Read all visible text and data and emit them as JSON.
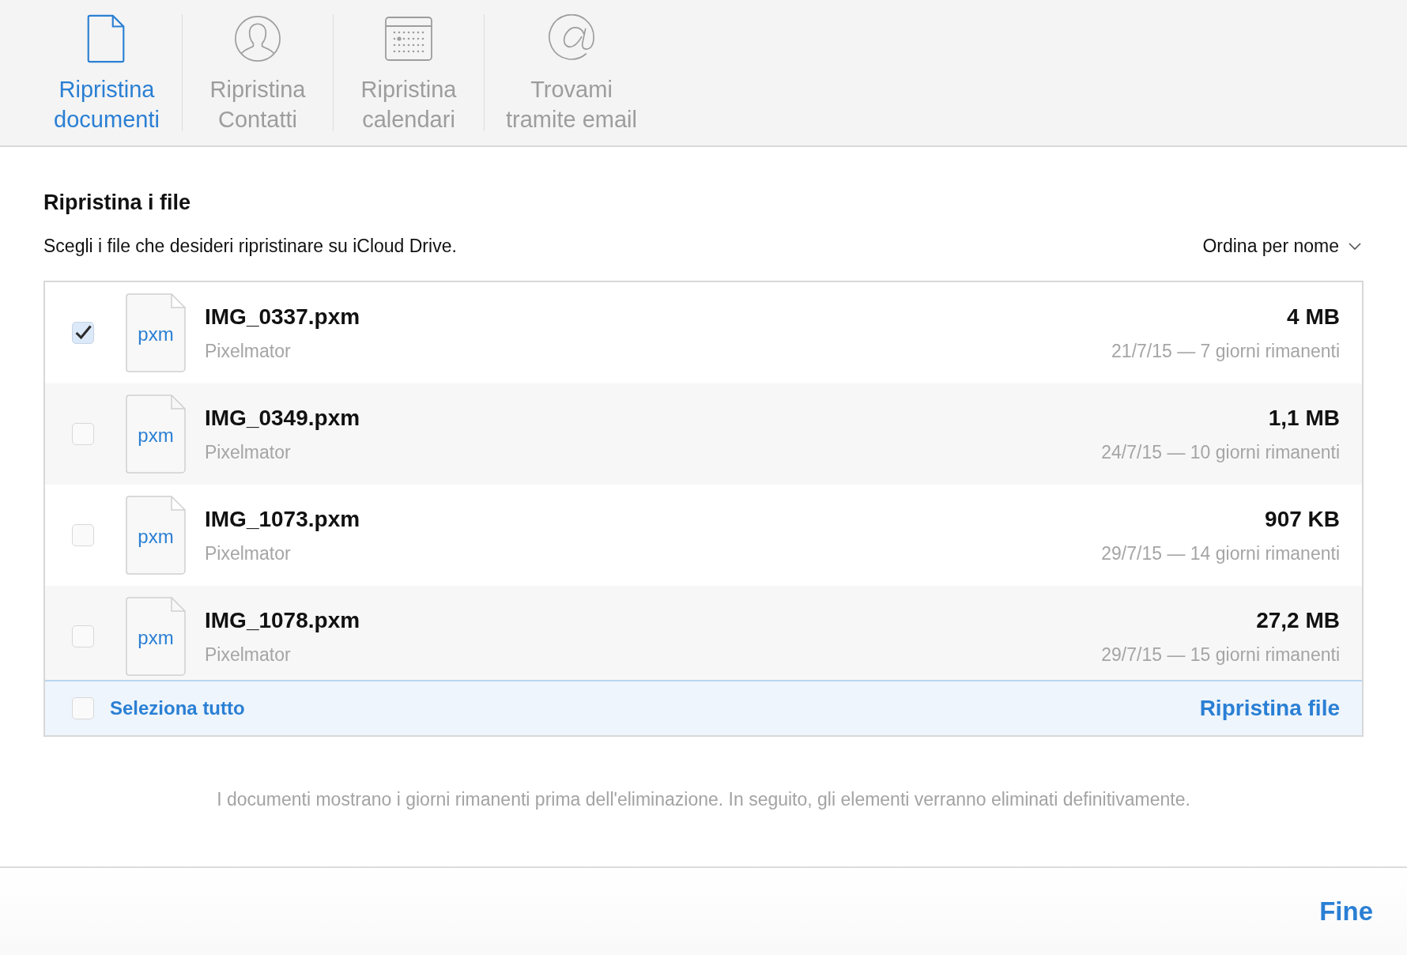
{
  "tabs": [
    {
      "kind": "document",
      "label": "Ripristina documenti",
      "selected": true
    },
    {
      "kind": "contact",
      "label": "Ripristina Contatti",
      "selected": false
    },
    {
      "kind": "calendar",
      "label": "Ripristina calendari",
      "selected": false
    },
    {
      "kind": "email",
      "label": "Trovami tramite email",
      "selected": false
    }
  ],
  "heading": "Ripristina i file",
  "subtitle": "Scegli i file che desideri ripristinare su iCloud Drive.",
  "sort": "Ordina per nome",
  "files": [
    {
      "icon_label": "pxm",
      "name": "IMG_0337.pxm",
      "app": "Pixelmator",
      "size": "4 MB",
      "date": "21/7/15 — 7 giorni rimanenti",
      "checked": true
    },
    {
      "icon_label": "pxm",
      "name": "IMG_0349.pxm",
      "app": "Pixelmator",
      "size": "1,1 MB",
      "date": "24/7/15 — 10 giorni rimanenti",
      "checked": false
    },
    {
      "icon_label": "pxm",
      "name": "IMG_1073.pxm",
      "app": "Pixelmator",
      "size": "907 KB",
      "date": "29/7/15 — 14 giorni rimanenti",
      "checked": false
    },
    {
      "icon_label": "pxm",
      "name": "IMG_1078.pxm",
      "app": "Pixelmator",
      "size": "27,2 MB",
      "date": "29/7/15 — 15 giorni rimanenti",
      "checked": false
    }
  ],
  "select_all": {
    "label": "Seleziona tutto",
    "checked": false
  },
  "restore_button": "Ripristina file",
  "note": "I documenti mostrano i giorni rimanenti prima dell'eliminazione. In seguito, gli elementi verranno eliminati definitivamente.",
  "done_button": "Fine"
}
